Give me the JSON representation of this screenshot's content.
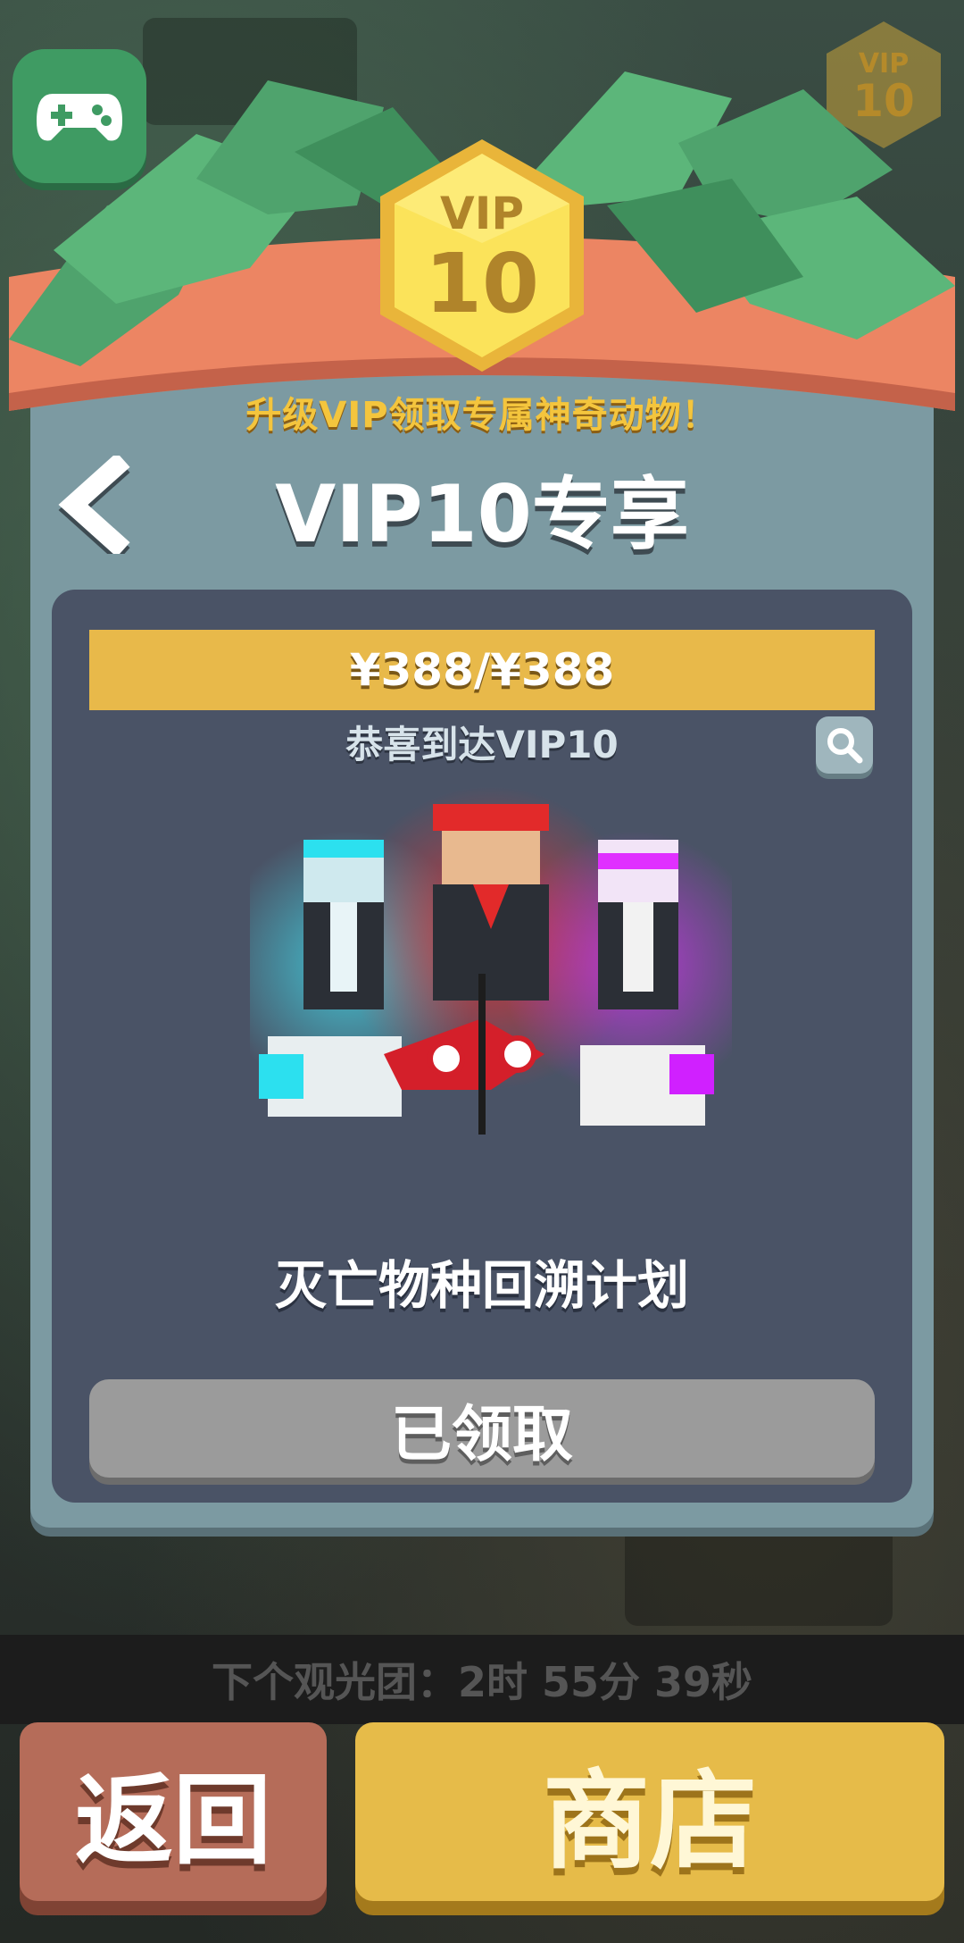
{
  "header": {
    "vip_badge_label": "VIP",
    "vip_badge_level": "10",
    "corner_vip_label": "VIP",
    "corner_vip_level": "10",
    "subtitle": "升级VIP领取专属神奇动物！"
  },
  "panel": {
    "title": "VIP10专享",
    "progress_text": "¥388/¥388",
    "progress_fraction": 1.0,
    "congrats_text": "恭喜到达VIP10",
    "reward_name": "灭亡物种回溯计划",
    "claimed_label": "已领取"
  },
  "footer": {
    "timer_text": "下个观光团：2时 55分 39秒",
    "return_label": "返回",
    "shop_label": "商店"
  },
  "icons": [
    "gamepad-icon",
    "back-arrow-icon",
    "magnifier-icon"
  ],
  "colors": {
    "gold": "#e8b94a",
    "panel": "#7c9aa2",
    "inner_panel": "#4a5366",
    "return_button": "#b56c59",
    "shop_button": "#e6bb49",
    "claimed_button": "#9b9b9b"
  }
}
